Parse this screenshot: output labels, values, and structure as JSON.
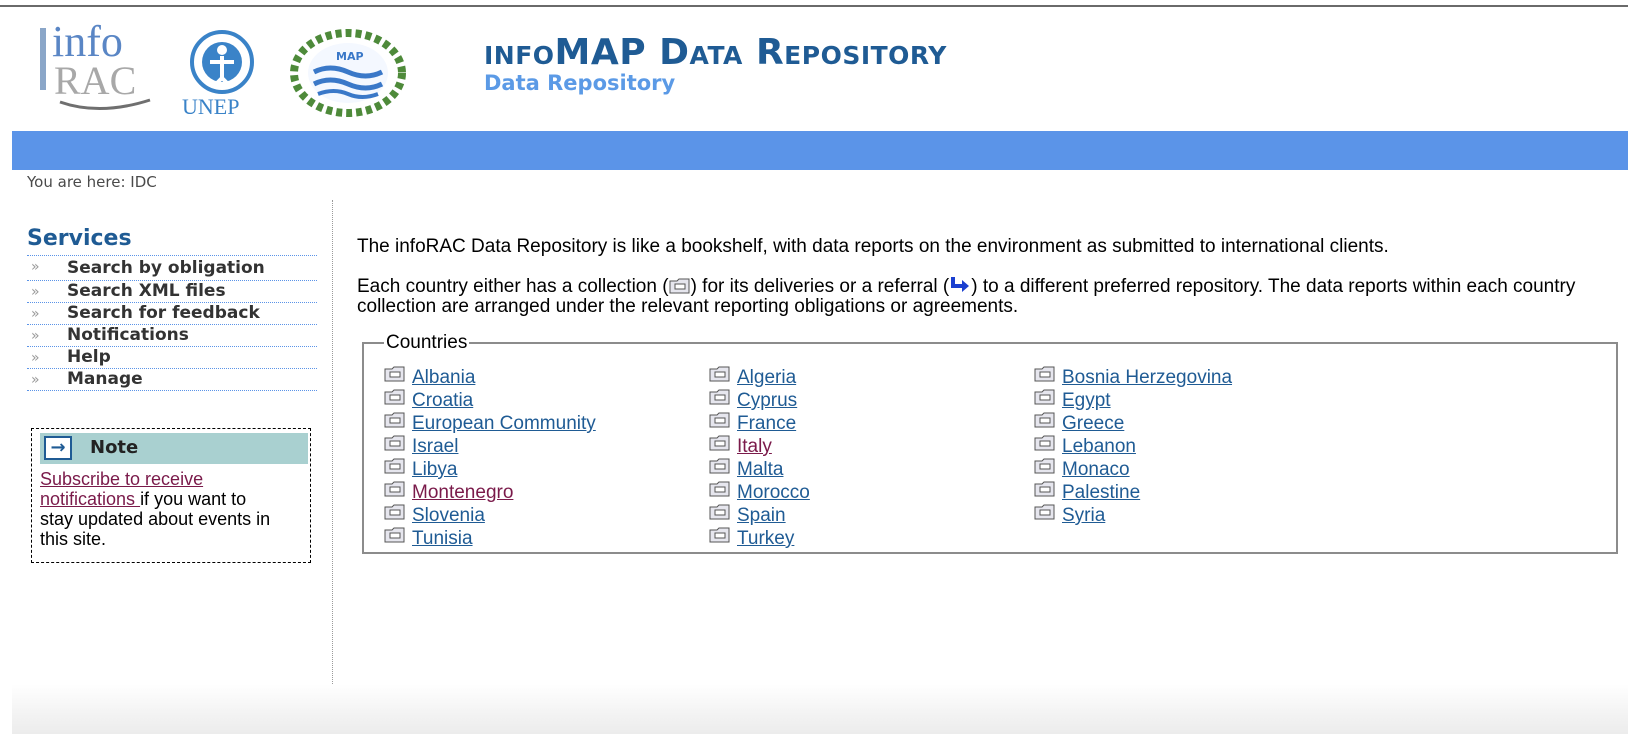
{
  "header": {
    "logos": {
      "info_top": "info",
      "info_bottom": "RAC",
      "unep": "UNEP",
      "map": "MAP"
    },
    "title": "infoMAP Data Repository",
    "subtitle": "Data Repository"
  },
  "breadcrumb": "You are here: IDC",
  "sidebar": {
    "title": "Services",
    "items": [
      {
        "label": "Search by obligation"
      },
      {
        "label": "Search XML files"
      },
      {
        "label": "Search for feedback"
      },
      {
        "label": "Notifications"
      },
      {
        "label": "Help"
      },
      {
        "label": "Manage"
      }
    ]
  },
  "note": {
    "title": "Note",
    "link_text": "Subscribe to receive notifications ",
    "text": "if you want to stay updated about events in this site."
  },
  "main": {
    "intro": "The infoRAC Data Repository is like a bookshelf, with data reports on the environment as submitted to international clients.",
    "desc_part1": "Each country either has a collection (",
    "desc_part2": ") for its deliveries or a referral (",
    "desc_part3": ") to a different preferred repository. The data reports within each country collection are arranged under the relevant reporting obligations or agreements."
  },
  "countries": {
    "legend": "Countries",
    "columns": [
      [
        {
          "name": "Albania",
          "visited": false
        },
        {
          "name": "Croatia",
          "visited": false
        },
        {
          "name": "European Community",
          "visited": false
        },
        {
          "name": "Israel",
          "visited": false
        },
        {
          "name": "Libya",
          "visited": false
        },
        {
          "name": "Montenegro",
          "visited": true
        },
        {
          "name": "Slovenia",
          "visited": false
        },
        {
          "name": "Tunisia",
          "visited": false
        }
      ],
      [
        {
          "name": "Algeria",
          "visited": false
        },
        {
          "name": "Cyprus",
          "visited": false
        },
        {
          "name": "France",
          "visited": false
        },
        {
          "name": "Italy",
          "visited": true
        },
        {
          "name": "Malta",
          "visited": false
        },
        {
          "name": "Morocco",
          "visited": false
        },
        {
          "name": "Spain",
          "visited": false
        },
        {
          "name": "Turkey",
          "visited": false
        }
      ],
      [
        {
          "name": "Bosnia Herzegovina",
          "visited": false
        },
        {
          "name": "Egypt",
          "visited": false
        },
        {
          "name": "Greece",
          "visited": false
        },
        {
          "name": "Lebanon",
          "visited": false
        },
        {
          "name": "Monaco",
          "visited": false
        },
        {
          "name": "Palestine",
          "visited": false
        },
        {
          "name": "Syria",
          "visited": false
        }
      ]
    ]
  },
  "colors": {
    "title_blue": "#1f5b94",
    "bar_blue": "#5b94e8",
    "link_blue": "#1f5b94",
    "visited_link": "#7a1a4a",
    "note_head": "#a9d0d0"
  },
  "icons": {
    "collection": "folder-icon",
    "referral": "referral-arrow-icon",
    "note": "arrow-right-icon"
  }
}
